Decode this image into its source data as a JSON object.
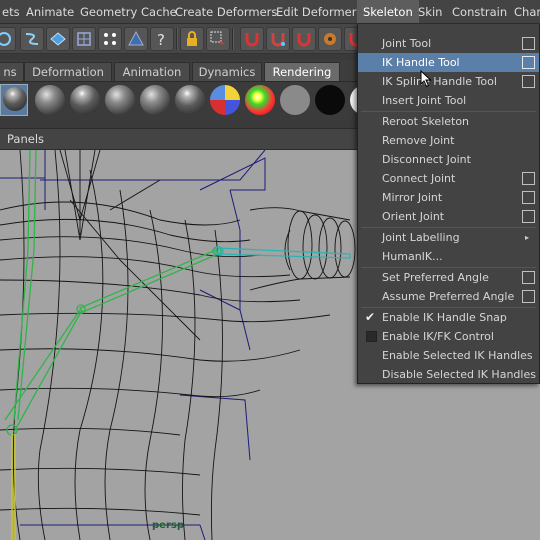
{
  "menubar": {
    "items": [
      "ets",
      "Animate",
      "Geometry Cache",
      "Create Deformers",
      "Edit Deformers",
      "Skeleton",
      "Skin",
      "Constrain",
      "Chara"
    ]
  },
  "tabs": [
    "ns",
    "Deformation",
    "Animation",
    "Dynamics",
    "Rendering"
  ],
  "active_tab": "Rendering",
  "panels_label": "Panels",
  "viewport_label": "persp",
  "skeleton_menu": {
    "items": [
      {
        "label": "Joint Tool",
        "option_box": true
      },
      {
        "label": "IK Handle Tool",
        "option_box": true,
        "highlighted": true
      },
      {
        "label": "IK Spline Handle Tool",
        "option_box": true
      },
      {
        "label": "Insert Joint Tool"
      },
      {
        "label": "Reroot Skeleton"
      },
      {
        "label": "Remove Joint"
      },
      {
        "label": "Disconnect Joint"
      },
      {
        "label": "Connect Joint",
        "option_box": true
      },
      {
        "label": "Mirror Joint",
        "option_box": true
      },
      {
        "label": "Orient Joint",
        "option_box": true
      },
      {
        "label": "Joint Labelling",
        "submenu": true
      },
      {
        "label": "HumanIK..."
      },
      {
        "label": "Set Preferred Angle",
        "option_box": true
      },
      {
        "label": "Assume Preferred Angle",
        "option_box": true
      },
      {
        "label": "Enable IK Handle Snap",
        "checked": true
      },
      {
        "label": "Enable IK/FK Control",
        "checked": false
      },
      {
        "label": "Enable Selected IK Handles"
      },
      {
        "label": "Disable Selected IK Handles"
      }
    ]
  },
  "colors": {
    "highlight": "#5a7fa8",
    "viewport_bg": "#a3a3a3",
    "joint_green": "#33bb44",
    "joint_cyan": "#33b5b5",
    "joint_yellow": "#c8c820"
  }
}
